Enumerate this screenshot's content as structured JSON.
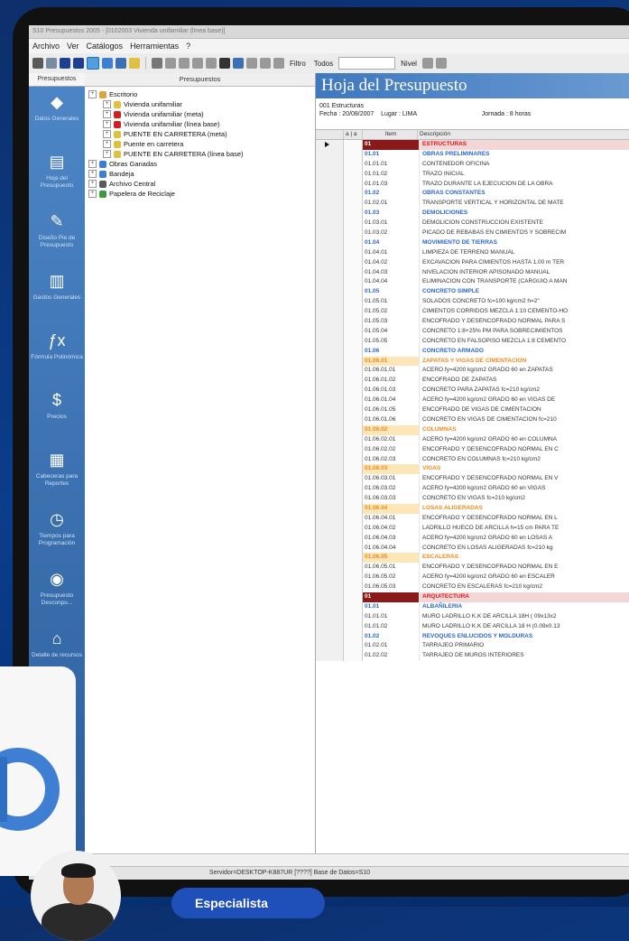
{
  "window": {
    "title": "S10 Presupuestos 2005 - [0102003 Vivienda unifamiliar (línea base)]"
  },
  "menu": [
    {
      "label": "Archivo"
    },
    {
      "label": "Ver"
    },
    {
      "label": "Catálogos"
    },
    {
      "label": "Herramientas"
    },
    {
      "label": "?"
    }
  ],
  "toolbar": {
    "filtro_label": "Filtro",
    "filtro_value": "Todos",
    "nivel_label": "Nivel"
  },
  "sidebar": {
    "tab": "Presupuestos",
    "items": [
      {
        "label": "Datos Generales",
        "icon": "diamond-icon"
      },
      {
        "label": "Hoja del Presupuesto",
        "icon": "sheet-icon"
      },
      {
        "label": "Diseño Pie de Presupuesto",
        "icon": "design-icon"
      },
      {
        "label": "Gastos Generales",
        "icon": "books-icon"
      },
      {
        "label": "Fórmula Polinómica",
        "icon": "fx-icon"
      },
      {
        "label": "Precios",
        "icon": "price-icon"
      },
      {
        "label": "Cabeceras para Reportes",
        "icon": "header-icon"
      },
      {
        "label": "Tiempos para Programación",
        "icon": "clock-icon"
      },
      {
        "label": "Presupuesto Desconpu...",
        "icon": "coins-icon"
      },
      {
        "label": "Detalle de recursos",
        "icon": "house-icon"
      }
    ]
  },
  "tree": {
    "header": "Presupuestos",
    "nodes": [
      {
        "label": "Escritorio",
        "level": 0,
        "color": "#d9a441"
      },
      {
        "label": "Vivienda unifamiliar",
        "level": 1,
        "color": "#e0c040"
      },
      {
        "label": "Vivienda unifamiliar (meta)",
        "level": 1,
        "color": "#d02020"
      },
      {
        "label": "Vivienda unifamiliar (línea base)",
        "level": 1,
        "color": "#d02020"
      },
      {
        "label": "PUENTE EN CARRETERA (meta)",
        "level": 1,
        "color": "#e0c040"
      },
      {
        "label": "Puente en carretera",
        "level": 1,
        "color": "#e0c040"
      },
      {
        "label": "PUENTE EN CARRETERA (línea base)",
        "level": 1,
        "color": "#e0c040"
      },
      {
        "label": "Obras Ganadas",
        "level": 0,
        "color": "#3d7fd3"
      },
      {
        "label": "Bandeja",
        "level": 0,
        "color": "#3d7fd3"
      },
      {
        "label": "Archivo Central",
        "level": 0,
        "color": "#5a5a5a"
      },
      {
        "label": "Papelera de Reciclaje",
        "level": 0,
        "color": "#3d9a3d"
      }
    ]
  },
  "sheet": {
    "title": "Hoja del Presupuesto",
    "subpresupuesto": "001   Estructuras",
    "fecha": "Fecha : 20/08/2007",
    "lugar": "Lugar : LIMA",
    "jornada": "Jornada : 8  horas",
    "col_item": "Item",
    "col_desc": "Descripción",
    "footer": "ESTRUCTURAS"
  },
  "rows": [
    {
      "item": "01",
      "desc": "ESTRUCTURAS",
      "lv": 0
    },
    {
      "item": "01.01",
      "desc": "OBRAS PRELIMINARES",
      "lv": 1
    },
    {
      "item": "01.01.01",
      "desc": "CONTENEDOR OFICINA",
      "lv": 3
    },
    {
      "item": "01.01.02",
      "desc": "TRAZO INICIAL",
      "lv": 3
    },
    {
      "item": "01.01.03",
      "desc": "TRAZO DURANTE LA EJECUCION DE LA OBRA",
      "lv": 3
    },
    {
      "item": "01.02",
      "desc": "OBRAS CONSTANTES",
      "lv": 1
    },
    {
      "item": "01.02.01",
      "desc": "TRANSPORTE VERTICAL Y HORIZONTAL DE MATE",
      "lv": 3
    },
    {
      "item": "01.03",
      "desc": "DEMOLICIONES",
      "lv": 1
    },
    {
      "item": "01.03.01",
      "desc": "DEMOLICION CONSTRUCCION EXISTENTE",
      "lv": 3
    },
    {
      "item": "01.03.02",
      "desc": "PICADO DE REBABAS EN CIMIENTOS Y SOBRECIM",
      "lv": 3
    },
    {
      "item": "01.04",
      "desc": "MOVIMIENTO DE TIERRAS",
      "lv": 1
    },
    {
      "item": "01.04.01",
      "desc": "LIMPIEZA DE TERRENO MANUAL",
      "lv": 3
    },
    {
      "item": "01.04.02",
      "desc": "EXCAVACION PARA CIMIENTOS HASTA 1.00 m TER",
      "lv": 3
    },
    {
      "item": "01.04.03",
      "desc": "NIVELACION INTERIOR APISONADO MANUAL",
      "lv": 3
    },
    {
      "item": "01.04.04",
      "desc": "ELIMINACION CON TRANSPORTE (CARGUIO A MAN",
      "lv": 3
    },
    {
      "item": "01.05",
      "desc": "CONCRETO SIMPLE",
      "lv": 1
    },
    {
      "item": "01.05.01",
      "desc": "SOLADOS CONCRETO fc=100 kg/cm2 h=2\"",
      "lv": 3
    },
    {
      "item": "01.05.02",
      "desc": "CIMIENTOS CORRIDOS MEZCLA 1:10 CEMENTO-HO",
      "lv": 3
    },
    {
      "item": "01.05.03",
      "desc": "ENCOFRADO Y DESENCOFRADO NORMAL PARA S",
      "lv": 3
    },
    {
      "item": "01.05.04",
      "desc": "CONCRETO 1:8+25% PM PARA SOBRECIMIENTOS",
      "lv": 3
    },
    {
      "item": "01.05.05",
      "desc": "CONCRETO EN FALSOPISO MEZCLA 1:8 CEMENTO",
      "lv": 3
    },
    {
      "item": "01.06",
      "desc": "CONCRETO ARMADO",
      "lv": 1
    },
    {
      "item": "01.06.01",
      "desc": "ZAPATAS Y VIGAS DE CIMENTACION",
      "lv": 2
    },
    {
      "item": "01.06.01.01",
      "desc": "ACERO fy=4200 kg/cm2 GRADO 60 en ZAPATAS",
      "lv": 3
    },
    {
      "item": "01.06.01.02",
      "desc": "ENCOFRADO DE ZAPATAS",
      "lv": 3
    },
    {
      "item": "01.06.01.03",
      "desc": "CONCRETO PARA ZAPATAS fc=210 kg/cm2",
      "lv": 3
    },
    {
      "item": "01.06.01.04",
      "desc": "ACERO fy=4200 kg/cm2 GRADO 60 en VIGAS DE",
      "lv": 3
    },
    {
      "item": "01.06.01.05",
      "desc": "ENCOFRADO DE VIGAS DE CIMENTACION",
      "lv": 3
    },
    {
      "item": "01.06.01.06",
      "desc": "CONCRETO EN VIGAS DE CIMENTACION fc=210",
      "lv": 3
    },
    {
      "item": "01.06.02",
      "desc": "COLUMNAS",
      "lv": 2
    },
    {
      "item": "01.06.02.01",
      "desc": "ACERO fy=4200 kg/cm2 GRADO 60 en COLUMNA",
      "lv": 3
    },
    {
      "item": "01.06.02.02",
      "desc": "ENCOFRADO Y DESENCOFRADO NORMAL EN C",
      "lv": 3
    },
    {
      "item": "01.06.02.03",
      "desc": "CONCRETO EN COLUMNAS fc=210 kg/cm2",
      "lv": 3
    },
    {
      "item": "01.06.03",
      "desc": "VIGAS",
      "lv": 2
    },
    {
      "item": "01.06.03.01",
      "desc": "ENCOFRADO Y DESENCOFRADO NORMAL EN V",
      "lv": 3
    },
    {
      "item": "01.06.03.02",
      "desc": "ACERO fy=4200 kg/cm2 GRADO 60 en VIGAS",
      "lv": 3
    },
    {
      "item": "01.06.03.03",
      "desc": "CONCRETO EN VIGAS fc=210 kg/cm2",
      "lv": 3
    },
    {
      "item": "01.06.04",
      "desc": "LOSAS ALIGERADAS",
      "lv": 2
    },
    {
      "item": "01.06.04.01",
      "desc": "ENCOFRADO Y DESENCOFRADO NORMAL EN L",
      "lv": 3
    },
    {
      "item": "01.06.04.02",
      "desc": "LADRILLO HUECO DE ARCILLA h=15 cm PARA TE",
      "lv": 3
    },
    {
      "item": "01.06.04.03",
      "desc": "ACERO fy=4200 kg/cm2 GRADO 60 en LOSAS A",
      "lv": 3
    },
    {
      "item": "01.06.04.04",
      "desc": "CONCRETO EN LOSAS ALIGERADAS fc=210 kg",
      "lv": 3
    },
    {
      "item": "01.06.05",
      "desc": "ESCALERAS",
      "lv": 2
    },
    {
      "item": "01.06.05.01",
      "desc": "ENCOFRADO Y DESENCOFRADO NORMAL EN E",
      "lv": 3
    },
    {
      "item": "01.06.05.02",
      "desc": "ACERO fy=4200 kg/cm2 GRADO 60 en ESCALER",
      "lv": 3
    },
    {
      "item": "01.06.05.03",
      "desc": "CONCRETO EN ESCALERAS fc=210 kg/cm2",
      "lv": 3
    },
    {
      "item": "01",
      "desc": "ARQUITECTURA",
      "lv": 0
    },
    {
      "item": "01.01",
      "desc": "ALBAÑILERIA",
      "lv": 1
    },
    {
      "item": "01.01.01",
      "desc": "MURO LADRILLO K.K DE ARCILLA 18H ( 09x13x2",
      "lv": 3
    },
    {
      "item": "01.01.02",
      "desc": "MURO LADRILLO K.K DE ARCILLA 18 H (0.09x0.13",
      "lv": 3
    },
    {
      "item": "01.02",
      "desc": "REVOQUES ENLUCIDOS Y MOLDURAS",
      "lv": 1
    },
    {
      "item": "01.02.01",
      "desc": "TARRAJEO PRIMARIO",
      "lv": 3
    },
    {
      "item": "01.02.02",
      "desc": "TARRAJEO DE MUROS INTERIORES",
      "lv": 3
    }
  ],
  "status": {
    "text": "Servidor=DESKTOP-K887UR [????]  Base de Datos=S10"
  },
  "overlay": {
    "logo_text": "O",
    "pill_text": "Especialista"
  }
}
